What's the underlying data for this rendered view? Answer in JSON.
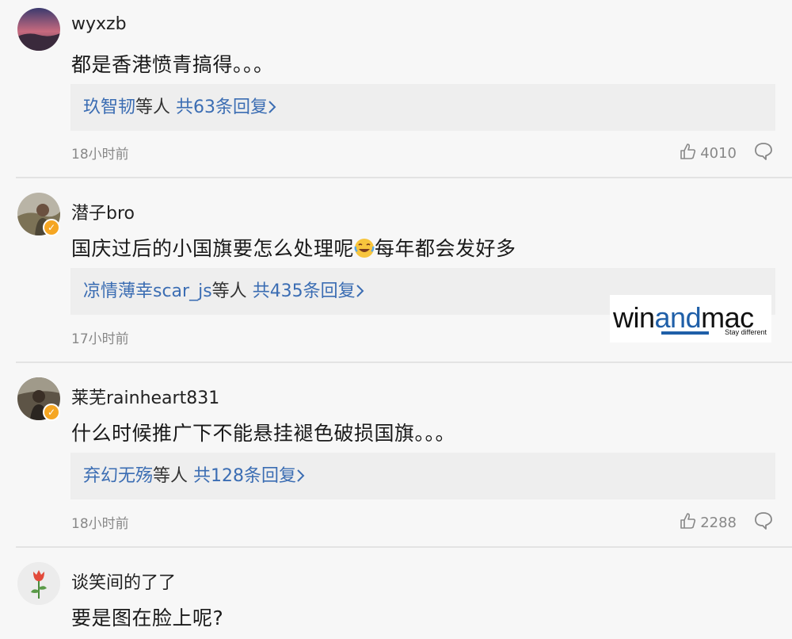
{
  "comments": [
    {
      "username": "wyxzb",
      "content": "都是香港愤青搞得。。。",
      "reply_names": "玖智韧",
      "reply_suffix": "等人",
      "reply_count": "共63条回复",
      "time": "18小时前",
      "likes": "4010"
    },
    {
      "username": "潜子bro",
      "content_before": "国庆过后的小国旗要怎么处理呢",
      "content_after": "每年都会发好多",
      "reply_names": "凉情薄幸scar_js",
      "reply_suffix": "等人",
      "reply_count": "共435条回复",
      "time": "17小时前"
    },
    {
      "username": "莱芜rainheart831",
      "content": "什么时候推广下不能悬挂褪色破损国旗。。。",
      "reply_names": "弃幻无殇",
      "reply_suffix": "等人",
      "reply_count": "共128条回复",
      "time": "18小时前",
      "likes": "2288"
    },
    {
      "username": "谈笑间的了了",
      "content": "要是图在脸上呢?"
    }
  ],
  "watermark": {
    "word_start": "win",
    "word_mid": "and",
    "word_end": "mac",
    "tagline": "Stay different"
  },
  "icons": [
    "like-icon",
    "comment-icon",
    "chevron-right-icon",
    "verified-icon",
    "laughing-emoji-icon"
  ],
  "colors": {
    "link_blue": "#3b6db3",
    "badge": "#f5a623",
    "background": "#f7f7f7"
  }
}
